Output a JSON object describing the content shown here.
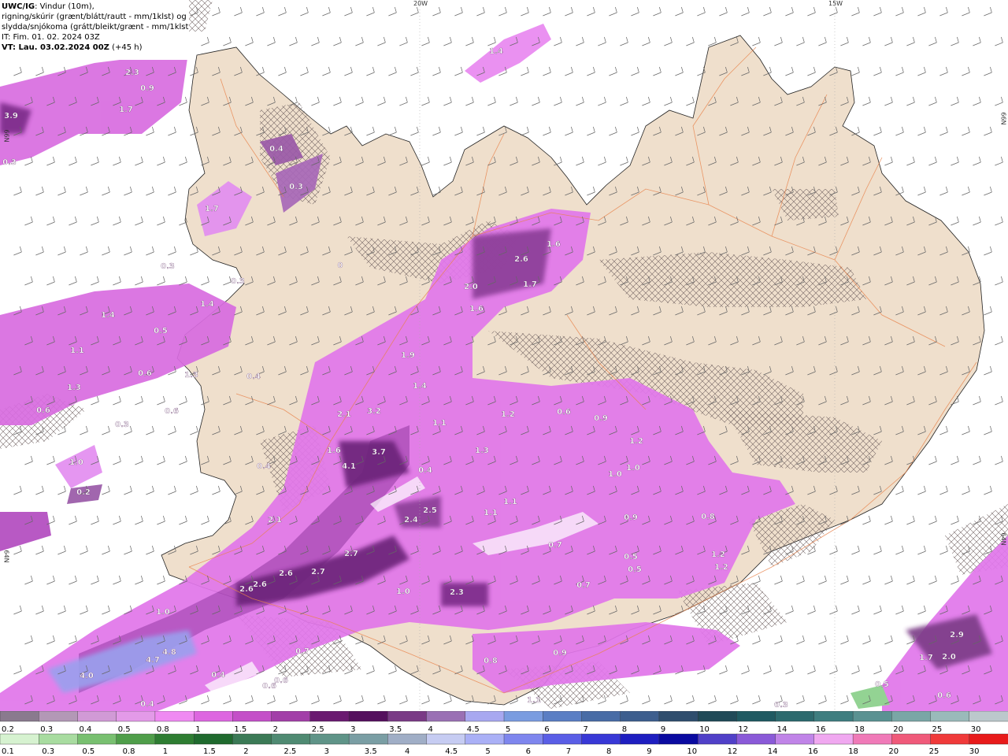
{
  "header": {
    "model": "UWC/IG",
    "line1_rest": ": Vindur (10m),",
    "line2": "rigning/skúrir (grænt/blátt/rautt - mm/1klst) og",
    "line3": "slydda/snjókoma (grátt/bleikt/grænt - mm/1klst)",
    "line4": "IT: Fim. 01. 02. 2024 03Z",
    "vt_label": "VT: Lau. 03.02.2024 00Z",
    "vt_rest": " (+45 h)"
  },
  "longitude_labels": [
    {
      "text": "20W"
    },
    {
      "text": "15W"
    }
  ],
  "latitude_labels": [
    {
      "text": "66N"
    },
    {
      "text": "64N"
    }
  ],
  "precip_labels": [
    {
      "text": "3.9"
    },
    {
      "text": "2.3"
    },
    {
      "text": "0.9"
    },
    {
      "text": "1.7"
    },
    {
      "text": "0.3"
    },
    {
      "text": "1.4"
    },
    {
      "text": "0.4"
    },
    {
      "text": "0.3"
    },
    {
      "text": "1.7"
    },
    {
      "text": "0.3"
    },
    {
      "text": "0"
    },
    {
      "text": "0.3"
    },
    {
      "text": "1.4"
    },
    {
      "text": "1.4"
    },
    {
      "text": "0.5"
    },
    {
      "text": "1.1"
    },
    {
      "text": "0.6"
    },
    {
      "text": "1.3"
    },
    {
      "text": "1.3"
    },
    {
      "text": "0.4"
    },
    {
      "text": "0.6"
    },
    {
      "text": "0.6"
    },
    {
      "text": "0.3"
    },
    {
      "text": "1.0"
    },
    {
      "text": "0.2"
    },
    {
      "text": "2.6"
    },
    {
      "text": "1.6"
    },
    {
      "text": "2.0"
    },
    {
      "text": "1.7"
    },
    {
      "text": "1.6"
    },
    {
      "text": "1.9"
    },
    {
      "text": "1.4"
    },
    {
      "text": "2.1"
    },
    {
      "text": "3.2"
    },
    {
      "text": "1.1"
    },
    {
      "text": "1.2"
    },
    {
      "text": "0.6"
    },
    {
      "text": "0.9"
    },
    {
      "text": "1.6"
    },
    {
      "text": "3.7"
    },
    {
      "text": "4.1"
    },
    {
      "text": "1.3"
    },
    {
      "text": "1.2"
    },
    {
      "text": "0.4"
    },
    {
      "text": "0.4"
    },
    {
      "text": "1.0"
    },
    {
      "text": "1.0"
    },
    {
      "text": "1.1"
    },
    {
      "text": "1.1"
    },
    {
      "text": "2.1"
    },
    {
      "text": "2.5"
    },
    {
      "text": "2.4"
    },
    {
      "text": "0.9"
    },
    {
      "text": "0.8"
    },
    {
      "text": "0.7"
    },
    {
      "text": "2.7"
    },
    {
      "text": "1.2"
    },
    {
      "text": "1.2"
    },
    {
      "text": "0.5"
    },
    {
      "text": "0.5"
    },
    {
      "text": "2.6"
    },
    {
      "text": "2.7"
    },
    {
      "text": "2.6"
    },
    {
      "text": "2.6"
    },
    {
      "text": "1.0"
    },
    {
      "text": "2.3"
    },
    {
      "text": "0.7"
    },
    {
      "text": "1.0"
    },
    {
      "text": "4.7"
    },
    {
      "text": "4.8"
    },
    {
      "text": "4.0"
    },
    {
      "text": "0.7"
    },
    {
      "text": "0.4"
    },
    {
      "text": "0.6"
    },
    {
      "text": "0.6"
    },
    {
      "text": "0.4"
    },
    {
      "text": "0.9"
    },
    {
      "text": "0.8"
    },
    {
      "text": "1.1"
    },
    {
      "text": "2.9"
    },
    {
      "text": "1.7"
    },
    {
      "text": "2.0"
    },
    {
      "text": "0.5"
    },
    {
      "text": "0.6"
    },
    {
      "text": "0.3"
    }
  ],
  "legend_snow": {
    "labels": [
      "0.2",
      "0.3",
      "0.4",
      "0.5",
      "0.8",
      "1",
      "1.5",
      "2",
      "2.5",
      "3",
      "3.5",
      "4",
      "4.5",
      "5",
      "6",
      "7",
      "8",
      "9",
      "10",
      "12",
      "14",
      "16",
      "18",
      "20",
      "25",
      "30"
    ],
    "colors": [
      "#8a7a8e",
      "#b398b6",
      "#d19ad6",
      "#e39ae8",
      "#ef8af2",
      "#dd66e0",
      "#c44fc8",
      "#a23ea8",
      "#6a1a70",
      "#55105e",
      "#7a3a86",
      "#9a70b4",
      "#a8a8f0",
      "#7a9ce0",
      "#5a7ec4",
      "#486ca6",
      "#3d5e8e",
      "#2f4e6e",
      "#204a58",
      "#1f5a62",
      "#2c6a6e",
      "#3e7e80",
      "#5a9292",
      "#7aa6a6",
      "#9ababa",
      "#bcc8cc"
    ]
  },
  "legend_rain": {
    "labels": [
      "0.1",
      "0.3",
      "0.5",
      "0.8",
      "1",
      "1.5",
      "2",
      "2.5",
      "3",
      "3.5",
      "4",
      "4.5",
      "5",
      "6",
      "7",
      "8",
      "9",
      "10",
      "12",
      "14",
      "16",
      "18",
      "20",
      "25",
      "30"
    ],
    "colors": [
      "#d6f2d0",
      "#a8dca0",
      "#78c070",
      "#4f9e4a",
      "#2e7d32",
      "#1f6a2e",
      "#3b7a56",
      "#4f8a72",
      "#5f9488",
      "#7a9ea4",
      "#a0aec6",
      "#c6ccf2",
      "#aab0f6",
      "#7e86ee",
      "#5a5ee6",
      "#3838d6",
      "#1e1ec0",
      "#0a0aa0",
      "#5040c8",
      "#8a5ad8",
      "#c084e8",
      "#f0a8f0",
      "#f07ab8",
      "#f05a7a",
      "#f03a3a",
      "#e81a1a"
    ]
  },
  "colors": {
    "land": "#efdfcc",
    "road": "#e8824a",
    "sea": "#ffffff"
  }
}
